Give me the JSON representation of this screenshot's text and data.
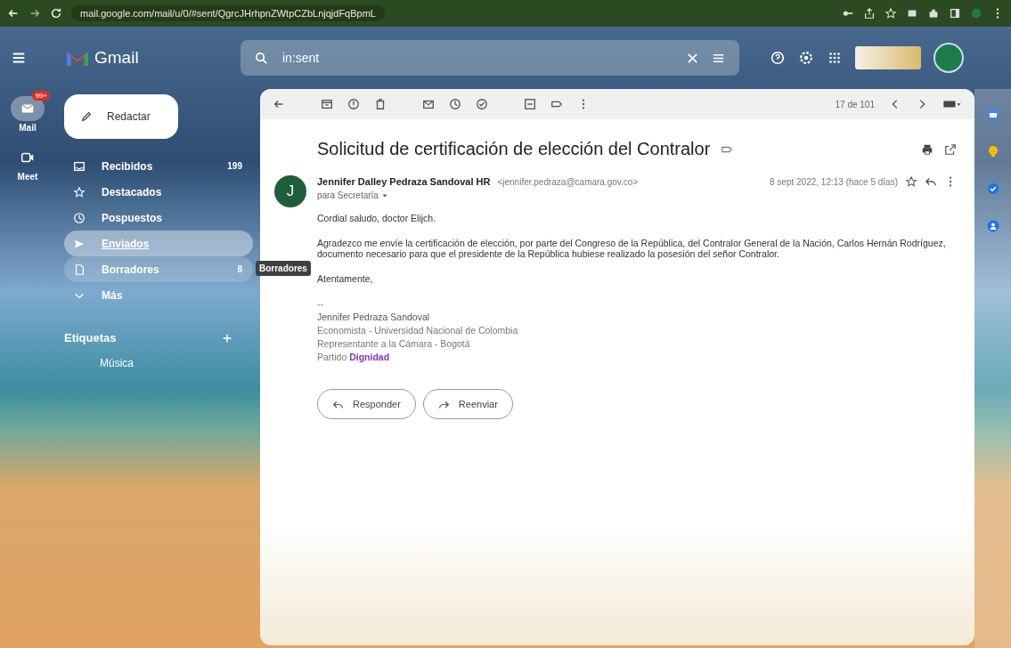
{
  "browser": {
    "url": "mail.google.com/mail/u/0/#sent/QgrcJHrhpnZWtpCZbLnjqjdFqBpmL"
  },
  "header": {
    "app_name": "Gmail",
    "search": {
      "value": "in:sent"
    }
  },
  "rail": [
    {
      "label": "Mail",
      "badge": "99+",
      "selected": true,
      "kind": "mail"
    },
    {
      "label": "Meet",
      "selected": false,
      "kind": "video"
    }
  ],
  "compose": {
    "label": "Redactar"
  },
  "sidebar": {
    "items": [
      {
        "label": "Recibidos",
        "count": "199",
        "selected": false,
        "hovered": false,
        "kind": "inbox"
      },
      {
        "label": "Destacados",
        "selected": false,
        "hovered": false,
        "kind": "star"
      },
      {
        "label": "Pospuestos",
        "selected": false,
        "hovered": false,
        "kind": "clock"
      },
      {
        "label": "Enviados",
        "selected": true,
        "hovered": false,
        "kind": "send"
      },
      {
        "label": "Borradores",
        "count": "8",
        "selected": false,
        "hovered": true,
        "kind": "file"
      },
      {
        "label": "Más",
        "selected": false,
        "hovered": false,
        "kind": "chevron"
      }
    ],
    "tooltip": "Borradores",
    "labels_heading": "Etiquetas",
    "labels": [
      {
        "label": "Música"
      }
    ]
  },
  "toolbar": {
    "counter": "17 de 101"
  },
  "message": {
    "subject": "Solicitud de certificación de elección del Contralor",
    "sender_initial": "J",
    "sender_name": "Jennifer Dalley Pedraza Sandoval HR",
    "sender_email": "<jennifer.pedraza@camara.gov.co>",
    "recipient": "para Secretaría",
    "date": "8 sept 2022, 12:13 (hace 5 días)",
    "greeting": "Cordial saludo, doctor Elijch.",
    "body": "Agradezco me envíe la certificación de elección, por parte del Congreso de la República, del Contralor General de la Nación, Carlos Hernán Rodríguez, documento necesario para que el presidente de la República hubiese realizado la posesión del señor Contralor.",
    "closing": "Atentamente,",
    "signature": [
      "--",
      "Jennifer Pedraza Sandoval",
      "Economista - Universidad Nacional de Colombia",
      "Representante a la Cámara - Bogotá"
    ],
    "party_label": "Partido",
    "party_name": "Dignidad",
    "actions": [
      {
        "label": "Responder",
        "kind": "reply"
      },
      {
        "label": "Reenviar",
        "kind": "forward"
      }
    ]
  }
}
